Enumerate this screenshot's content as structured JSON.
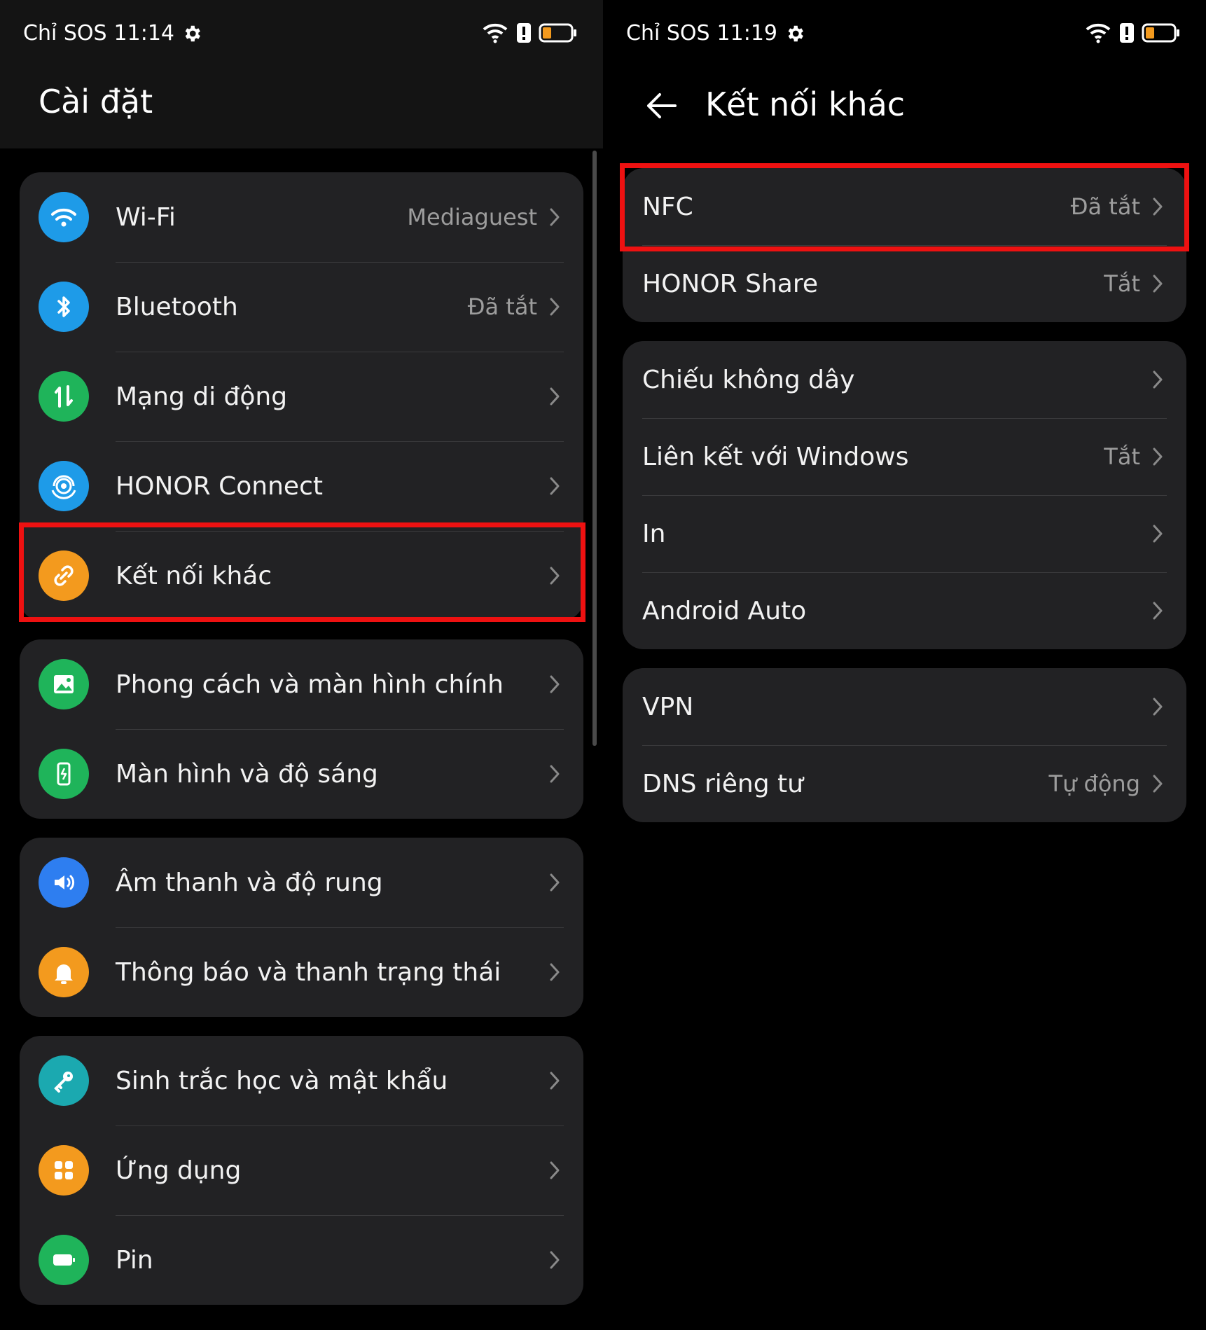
{
  "left_screen": {
    "status": {
      "carrier": "Chỉ SOS",
      "time": "11:14"
    },
    "title": "Cài đặt",
    "groups": [
      {
        "items": [
          {
            "label": "Wi-Fi",
            "value": "Mediaguest",
            "icon": "wifi-icon",
            "color": "#1e9be8"
          },
          {
            "label": "Bluetooth",
            "value": "Đã tắt",
            "icon": "bluetooth-icon",
            "color": "#1e9be8"
          },
          {
            "label": "Mạng di động",
            "value": "",
            "icon": "mobile-data-icon",
            "color": "#1fb45a"
          },
          {
            "label": "HONOR Connect",
            "value": "",
            "icon": "honor-connect-icon",
            "color": "#1e9be8"
          },
          {
            "label": "Kết nối khác",
            "value": "",
            "icon": "link-icon",
            "color": "#f39a1e"
          }
        ]
      },
      {
        "items": [
          {
            "label": "Phong cách và màn hình chính",
            "value": "",
            "icon": "image-icon",
            "color": "#1fb45a"
          },
          {
            "label": "Màn hình và độ sáng",
            "value": "",
            "icon": "phone-brightness-icon",
            "color": "#1fb45a"
          }
        ]
      },
      {
        "items": [
          {
            "label": "Âm thanh và độ rung",
            "value": "",
            "icon": "speaker-icon",
            "color": "#2e7ef0"
          },
          {
            "label": "Thông báo và thanh trạng thái",
            "value": "",
            "icon": "bell-icon",
            "color": "#f39a1e"
          }
        ]
      },
      {
        "items": [
          {
            "label": "Sinh trắc học và mật khẩu",
            "value": "",
            "icon": "key-icon",
            "color": "#1ba9b0"
          },
          {
            "label": "Ứng dụng",
            "value": "",
            "icon": "apps-icon",
            "color": "#f39a1e"
          },
          {
            "label": "Pin",
            "value": "",
            "icon": "battery-icon",
            "color": "#1fb45a"
          }
        ]
      }
    ]
  },
  "right_screen": {
    "status": {
      "carrier": "Chỉ SOS",
      "time": "11:19"
    },
    "title": "Kết nối khác",
    "groups": [
      {
        "items": [
          {
            "label": "NFC",
            "value": "Đã tắt"
          },
          {
            "label": "HONOR Share",
            "value": "Tắt"
          }
        ]
      },
      {
        "items": [
          {
            "label": "Chiếu không dây",
            "value": ""
          },
          {
            "label": "Liên kết với Windows",
            "value": "Tắt"
          },
          {
            "label": "In",
            "value": ""
          },
          {
            "label": "Android Auto",
            "value": ""
          }
        ]
      },
      {
        "items": [
          {
            "label": "VPN",
            "value": ""
          },
          {
            "label": "DNS riêng tư",
            "value": "Tự động"
          }
        ]
      }
    ]
  },
  "colors": {
    "highlight": "#ee1111",
    "card": "#222224",
    "battery_low": "#f39a1e"
  }
}
